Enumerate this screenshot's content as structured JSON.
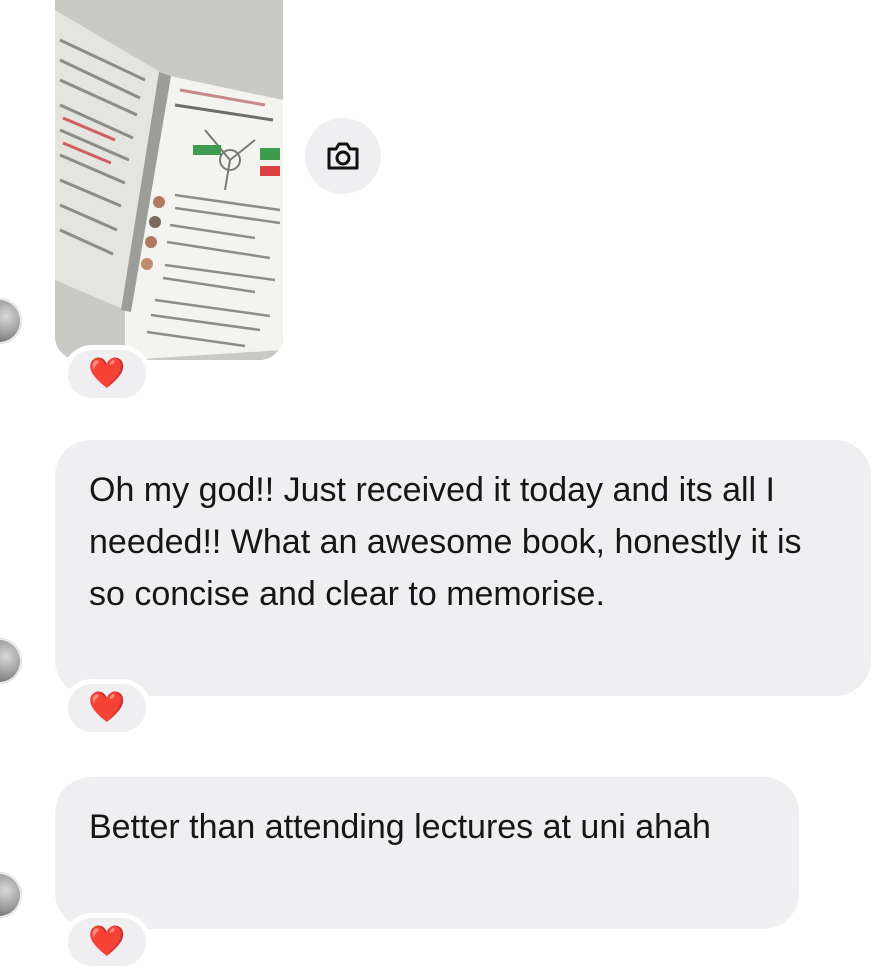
{
  "conversation": {
    "messages": [
      {
        "type": "photo",
        "reaction": "❤️"
      },
      {
        "type": "text",
        "text": "Oh my god!! Just received it today and its all I needed!! What an awesome book, honestly it is so concise and clear to memorise.",
        "reaction": "❤️"
      },
      {
        "type": "text",
        "text": "Better than attending lectures at uni ahah",
        "reaction": "❤️"
      }
    ]
  },
  "icons": {
    "photo_action": "camera-icon",
    "reaction": "red-heart-icon",
    "sender": "avatar"
  }
}
